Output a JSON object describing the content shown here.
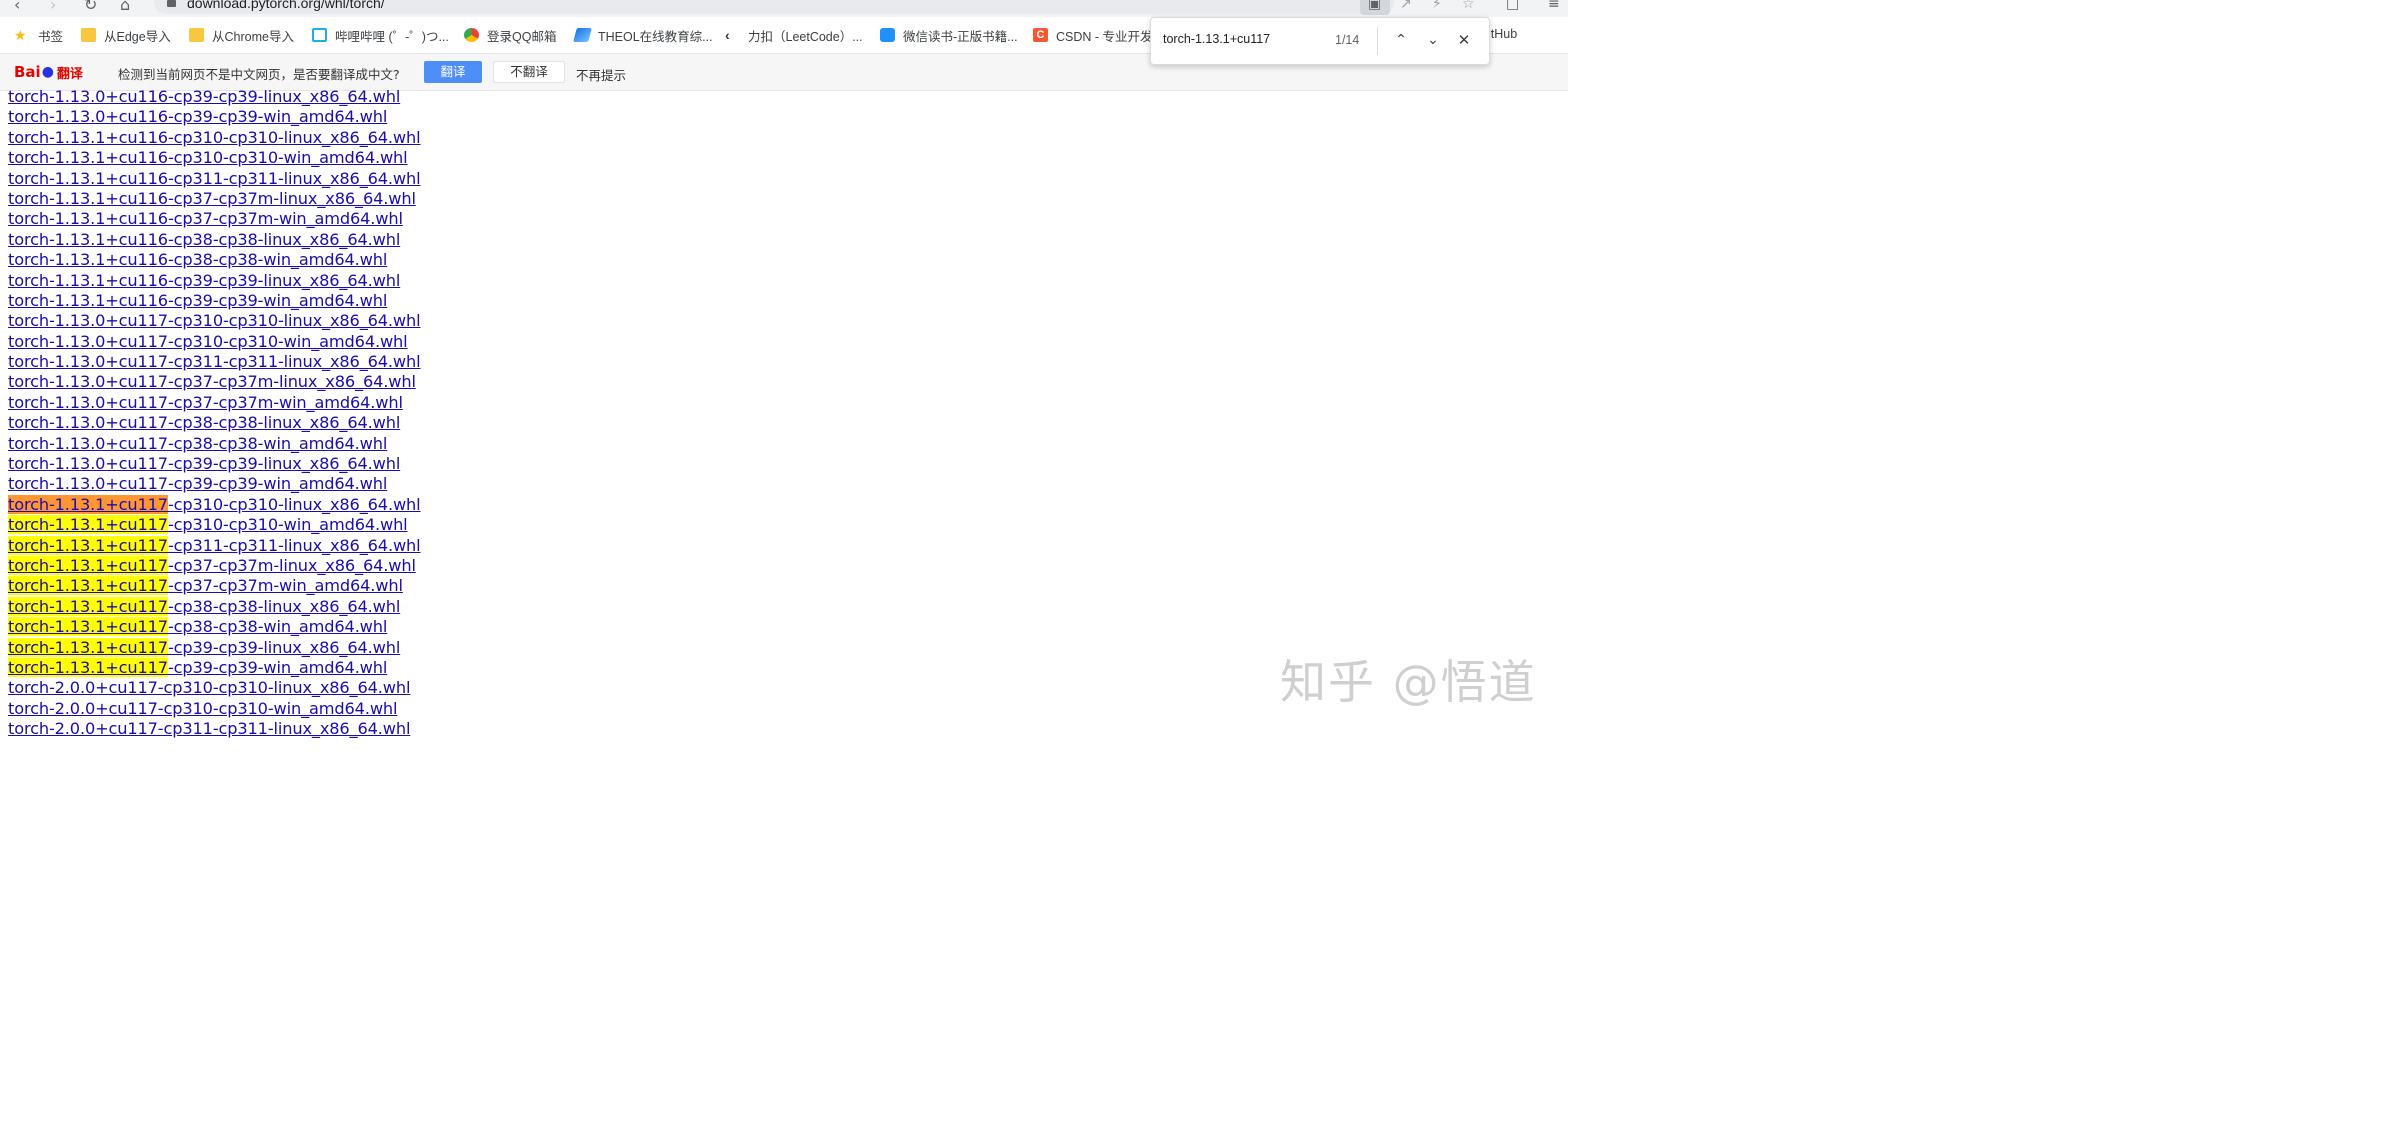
{
  "browser": {
    "url": "download.pytorch.org/whl/torch/",
    "bookmarks": [
      {
        "label": "书签",
        "icon": "star-icon",
        "color": "#fbbc04"
      },
      {
        "label": "从Edge导入",
        "icon": "folder-icon",
        "color": "#f9c640"
      },
      {
        "label": "从Chrome导入",
        "icon": "folder-icon",
        "color": "#f9c640"
      },
      {
        "label": "哔哩哔哩 (゜-゜)つ...",
        "icon": "bilibili-icon",
        "color": "#23ade5"
      },
      {
        "label": "登录QQ邮箱",
        "icon": "chrome-icon",
        "color": "#ea4335"
      },
      {
        "label": "THEOL在线教育综...",
        "icon": "theol-icon",
        "color": "#1a73e8"
      },
      {
        "label": "力扣（LeetCode）...",
        "icon": "leetcode-icon",
        "color": "#ffa116"
      },
      {
        "label": "微信读书-正版书籍...",
        "icon": "weread-icon",
        "color": "#1e90ff"
      },
      {
        "label": "CSDN - 专业开发",
        "icon": "csdn-icon",
        "color": "#fc5531"
      }
    ],
    "github_label": "itHub"
  },
  "translate_bar": {
    "logo_text_1": "Bai",
    "logo_text_2": "翻译",
    "message": "检测到当前网页不是中文网页，是否要翻译成中文?",
    "translate_button": "翻译",
    "no_translate_button": "不翻译",
    "never_button": "不再提示"
  },
  "find_bar": {
    "query": "torch-1.13.1+cu117",
    "count": "1/14"
  },
  "links": [
    {
      "text": "torch-1.13.0+cu116-cp39-cp39-linux_x86_64.whl"
    },
    {
      "text": "torch-1.13.0+cu116-cp39-cp39-win_amd64.whl"
    },
    {
      "text": "torch-1.13.1+cu116-cp310-cp310-linux_x86_64.whl"
    },
    {
      "text": "torch-1.13.1+cu116-cp310-cp310-win_amd64.whl"
    },
    {
      "text": "torch-1.13.1+cu116-cp311-cp311-linux_x86_64.whl"
    },
    {
      "text": "torch-1.13.1+cu116-cp37-cp37m-linux_x86_64.whl"
    },
    {
      "text": "torch-1.13.1+cu116-cp37-cp37m-win_amd64.whl"
    },
    {
      "text": "torch-1.13.1+cu116-cp38-cp38-linux_x86_64.whl"
    },
    {
      "text": "torch-1.13.1+cu116-cp38-cp38-win_amd64.whl"
    },
    {
      "text": "torch-1.13.1+cu116-cp39-cp39-linux_x86_64.whl"
    },
    {
      "text": "torch-1.13.1+cu116-cp39-cp39-win_amd64.whl"
    },
    {
      "text": "torch-1.13.0+cu117-cp310-cp310-linux_x86_64.whl"
    },
    {
      "text": "torch-1.13.0+cu117-cp310-cp310-win_amd64.whl"
    },
    {
      "text": "torch-1.13.0+cu117-cp311-cp311-linux_x86_64.whl"
    },
    {
      "text": "torch-1.13.0+cu117-cp37-cp37m-linux_x86_64.whl"
    },
    {
      "text": "torch-1.13.0+cu117-cp37-cp37m-win_amd64.whl"
    },
    {
      "text": "torch-1.13.0+cu117-cp38-cp38-linux_x86_64.whl"
    },
    {
      "text": "torch-1.13.0+cu117-cp38-cp38-win_amd64.whl"
    },
    {
      "text": "torch-1.13.0+cu117-cp39-cp39-linux_x86_64.whl"
    },
    {
      "text": "torch-1.13.0+cu117-cp39-cp39-win_amd64.whl"
    },
    {
      "text": "torch-1.13.1+cu117-cp310-cp310-linux_x86_64.whl",
      "highlight": "active"
    },
    {
      "text": "torch-1.13.1+cu117-cp310-cp310-win_amd64.whl",
      "highlight": "match"
    },
    {
      "text": "torch-1.13.1+cu117-cp311-cp311-linux_x86_64.whl",
      "highlight": "match"
    },
    {
      "text": "torch-1.13.1+cu117-cp37-cp37m-linux_x86_64.whl",
      "highlight": "match"
    },
    {
      "text": "torch-1.13.1+cu117-cp37-cp37m-win_amd64.whl",
      "highlight": "match"
    },
    {
      "text": "torch-1.13.1+cu117-cp38-cp38-linux_x86_64.whl",
      "highlight": "match"
    },
    {
      "text": "torch-1.13.1+cu117-cp38-cp38-win_amd64.whl",
      "highlight": "match"
    },
    {
      "text": "torch-1.13.1+cu117-cp39-cp39-linux_x86_64.whl",
      "highlight": "match"
    },
    {
      "text": "torch-1.13.1+cu117-cp39-cp39-win_amd64.whl",
      "highlight": "match"
    },
    {
      "text": "torch-2.0.0+cu117-cp310-cp310-linux_x86_64.whl"
    },
    {
      "text": "torch-2.0.0+cu117-cp310-cp310-win_amd64.whl"
    },
    {
      "text": "torch-2.0.0+cu117-cp311-cp311-linux_x86_64.whl"
    }
  ],
  "colors": {
    "link": "#1a0dab",
    "find_match": "#ffff00",
    "find_active": "#ff9632",
    "translate_button": "#4e8ef7"
  },
  "watermark": "知乎 @悟道"
}
